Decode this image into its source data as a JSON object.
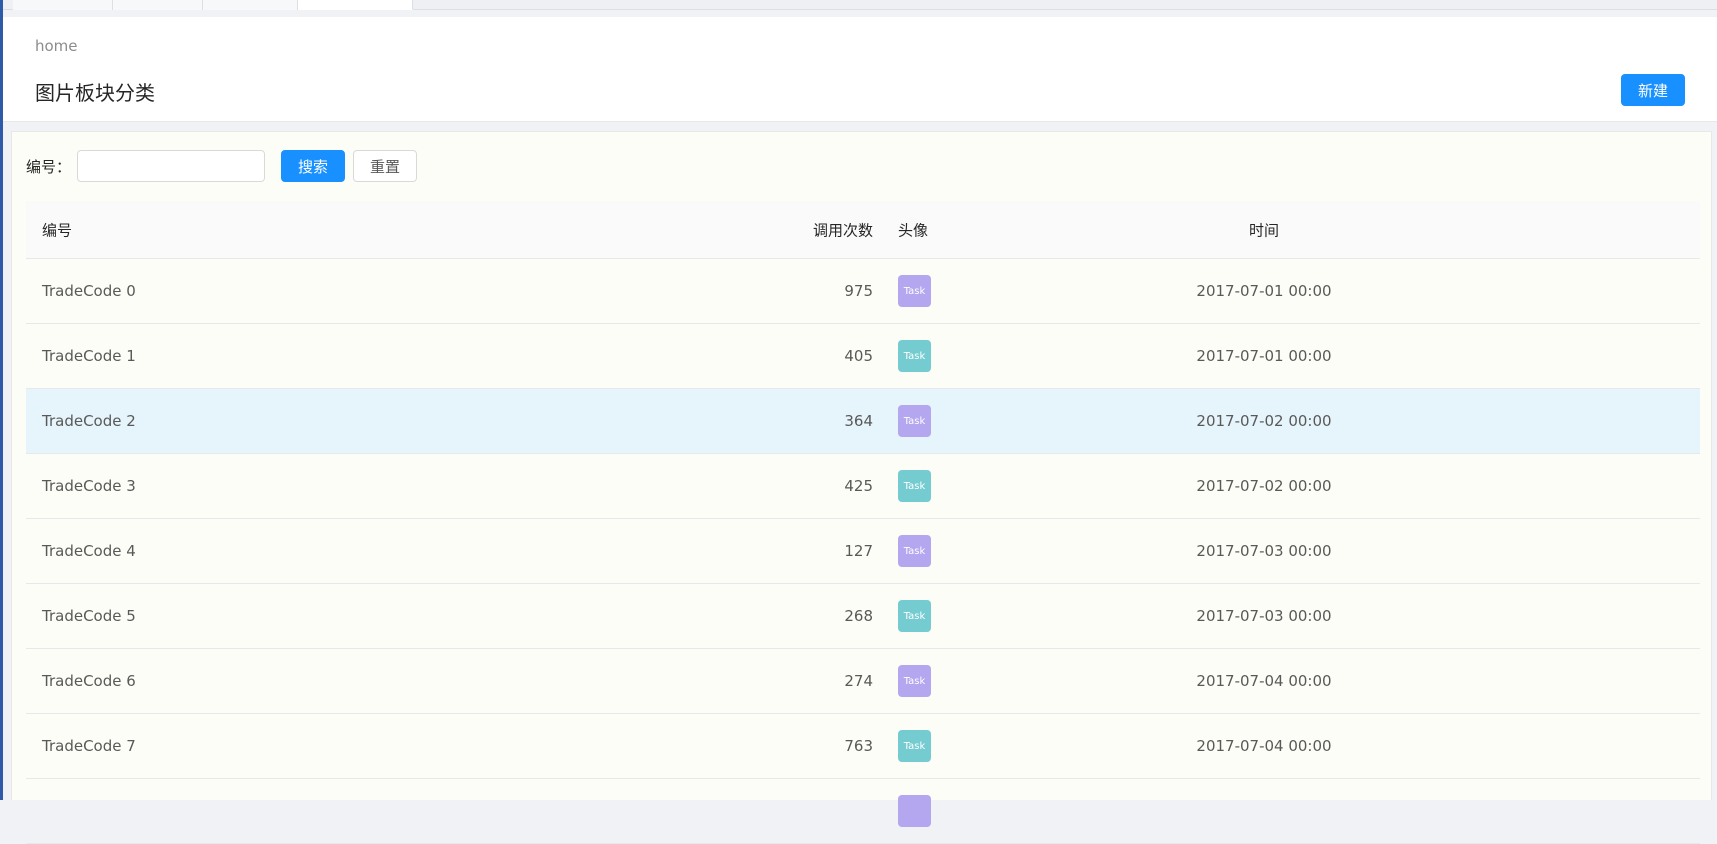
{
  "header": {
    "breadcrumb": "home",
    "title": "图片板块分类",
    "new_button": "新建"
  },
  "search": {
    "label": "编号：",
    "value": "",
    "placeholder": "",
    "search_button": "搜索",
    "reset_button": "重置"
  },
  "table": {
    "columns": [
      "编号",
      "调用次数",
      "头像",
      "时间"
    ],
    "rows": [
      {
        "code": "TradeCode 0",
        "count": "975",
        "avatar": "Task",
        "avatar_color": "#b4a7ef",
        "time": "2017-07-01 00:00"
      },
      {
        "code": "TradeCode 1",
        "count": "405",
        "avatar": "Task",
        "avatar_color": "#75ccd0",
        "time": "2017-07-01 00:00"
      },
      {
        "code": "TradeCode 2",
        "count": "364",
        "avatar": "Task",
        "avatar_color": "#b4a7ef",
        "time": "2017-07-02 00:00"
      },
      {
        "code": "TradeCode 3",
        "count": "425",
        "avatar": "Task",
        "avatar_color": "#75ccd0",
        "time": "2017-07-02 00:00"
      },
      {
        "code": "TradeCode 4",
        "count": "127",
        "avatar": "Task",
        "avatar_color": "#b4a7ef",
        "time": "2017-07-03 00:00"
      },
      {
        "code": "TradeCode 5",
        "count": "268",
        "avatar": "Task",
        "avatar_color": "#75ccd0",
        "time": "2017-07-03 00:00"
      },
      {
        "code": "TradeCode 6",
        "count": "274",
        "avatar": "Task",
        "avatar_color": "#b4a7ef",
        "time": "2017-07-04 00:00"
      },
      {
        "code": "TradeCode 7",
        "count": "763",
        "avatar": "Task",
        "avatar_color": "#75ccd0",
        "time": "2017-07-04 00:00"
      },
      {
        "code": "",
        "count": "",
        "avatar": "",
        "avatar_color": "#b4a7ef",
        "time": ""
      }
    ]
  },
  "colors": {
    "primary": "#1890ff",
    "row_highlight": "#e6f5fc",
    "avatar_purple": "#b4a7ef",
    "avatar_teal": "#75ccd0"
  }
}
